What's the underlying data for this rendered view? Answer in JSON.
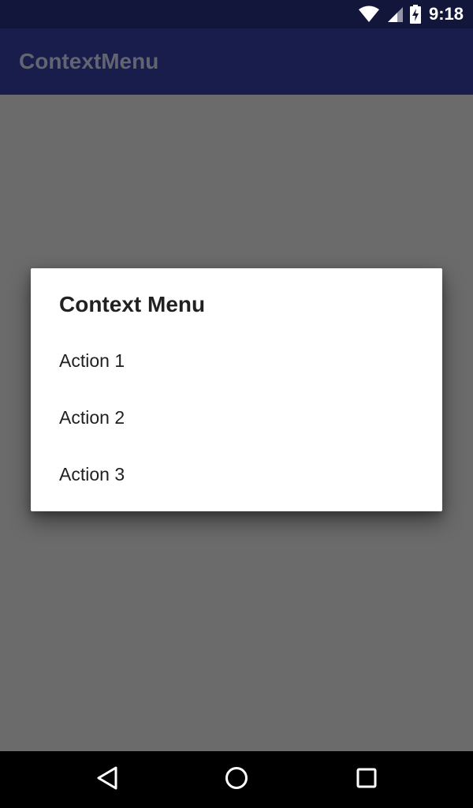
{
  "status_bar": {
    "time": "9:18",
    "icons": [
      "wifi-icon",
      "cell-signal-icon",
      "battery-charging-icon"
    ]
  },
  "app_bar": {
    "title": "ContextMenu"
  },
  "dialog": {
    "title": "Context Menu",
    "items": [
      {
        "label": "Action 1"
      },
      {
        "label": "Action 2"
      },
      {
        "label": "Action 3"
      }
    ]
  },
  "nav_bar": {
    "icons": [
      "back-icon",
      "home-icon",
      "recents-icon"
    ]
  },
  "colors": {
    "status_bar": "#12163a",
    "app_bar": "#181d4b",
    "scrim": "#6b6b6b",
    "dialog_bg": "#ffffff",
    "text": "#212121"
  }
}
